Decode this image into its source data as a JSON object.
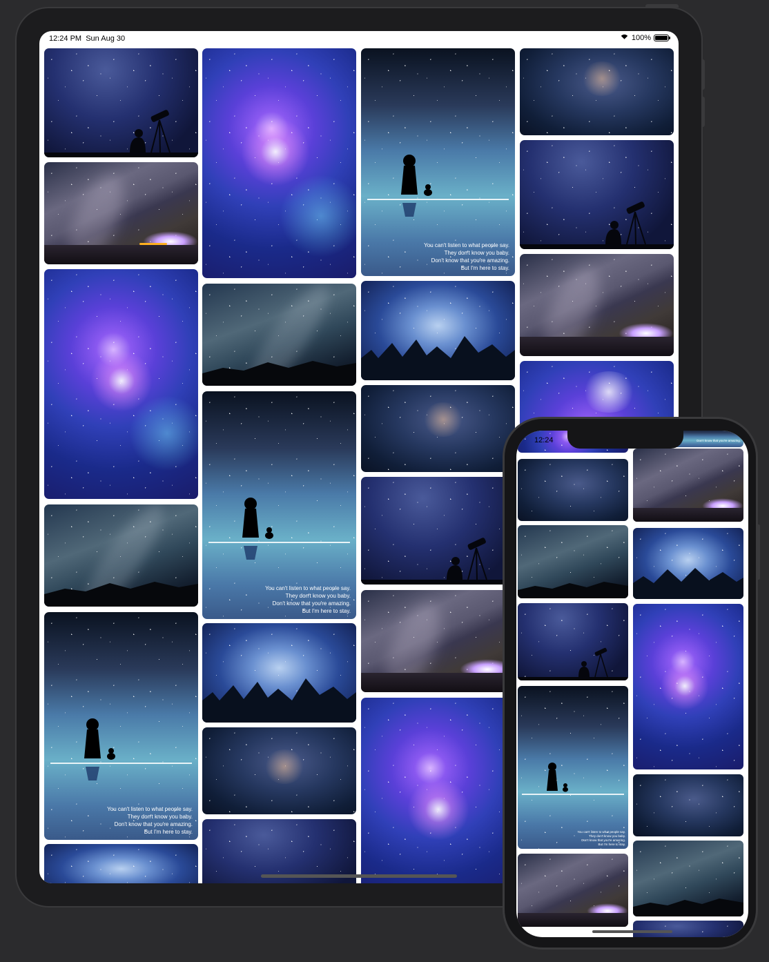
{
  "ipad": {
    "status": {
      "time": "12:24 PM",
      "date": "Sun Aug 30",
      "battery": "100%"
    },
    "quote": {
      "line1": "You can't listen to what people say.",
      "line2": "They don't know you baby.",
      "line3": "Don't know that you're amazing.",
      "line4": "But I'm here to stay."
    }
  },
  "iphone": {
    "status": {
      "time": "12:24"
    },
    "top_peek_text": "Don't know that you're amazing."
  },
  "gallery": {
    "image_themes": [
      "telescope-silhouette",
      "purple-galaxy",
      "girl-and-cat-reflection",
      "milky-way-horizon",
      "milky-way-mountains",
      "nebula-clouds-trees",
      "deep-space-nebula"
    ],
    "ipad_columns": 4,
    "iphone_columns": 2
  },
  "colors": {
    "screen_bg": "#ffffff",
    "device_frame": "#1c1c1e",
    "backdrop": "#2b2b2d"
  }
}
